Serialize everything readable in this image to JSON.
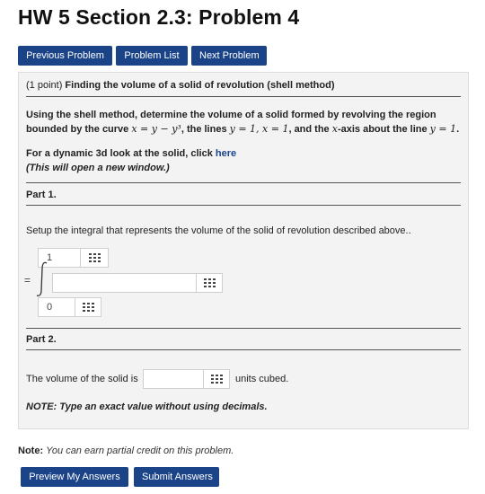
{
  "page": {
    "title": "HW 5 Section 2.3: Problem 4"
  },
  "nav": {
    "previous": "Previous Problem",
    "list": "Problem List",
    "next": "Next Problem"
  },
  "problem": {
    "points": "(1 point)",
    "heading": "Finding the volume of a solid of revolution (shell method)",
    "text_before": "Using the shell method, determine the volume of a solid formed by revolving the region bounded by the curve ",
    "curve": "x = y − y³",
    "text_lines": ", the lines ",
    "lines": "y = 1, x = 1",
    "text_and": ", and the ",
    "axis_var": "x",
    "text_axis": "-axis about the line ",
    "about_line": "y = 1",
    "text_end": ".",
    "dyn_prefix": "For a dynamic 3d look at the solid, click ",
    "dyn_link": "here",
    "dyn_note": "(This will open a new window.)"
  },
  "part1": {
    "label": "Part 1.",
    "instruction": "Setup the integral that represents the volume of the solid of revolution described above..",
    "equals": "=",
    "upper_limit": "1",
    "integrand": "",
    "lower_limit": "0"
  },
  "part2": {
    "label": "Part 2.",
    "volume_label": "The volume of the solid is",
    "volume_value": "",
    "units": "units cubed.",
    "note": "NOTE: Type an exact value without using decimals."
  },
  "footer": {
    "note_label": "Note:",
    "note_text": "You can earn partial credit on this problem.",
    "preview": "Preview My Answers",
    "submit": "Submit Answers"
  },
  "colors": {
    "button": "#1a4388",
    "panel": "#f3f3f3",
    "link": "#1a4388"
  },
  "icons": {
    "equation_editor": "grid-icon",
    "integral": "integral-sign-icon"
  }
}
